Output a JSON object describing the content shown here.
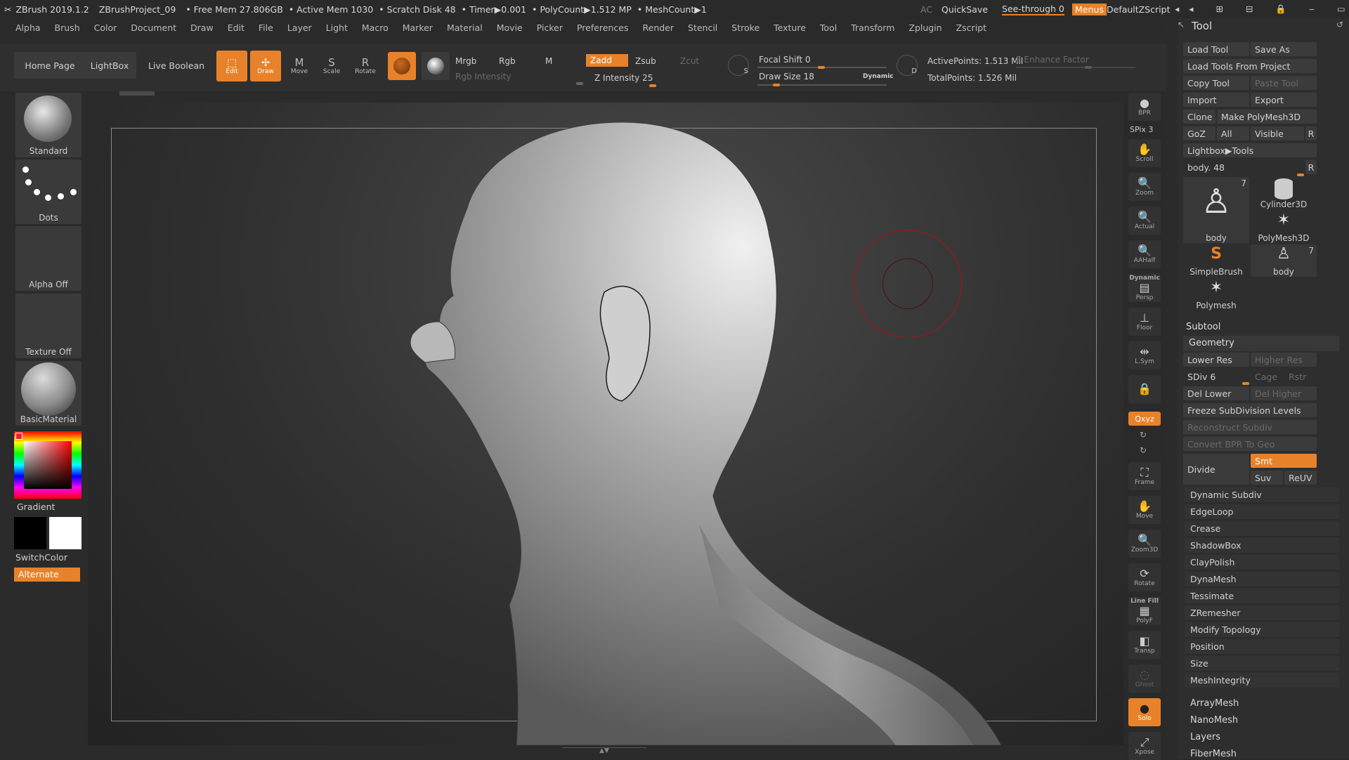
{
  "titlebar": {
    "app": "ZBrush 2019.1.2",
    "project": "ZBrushProject_09",
    "free_mem": "• Free Mem 27.806GB",
    "active_mem": "• Active Mem 1030",
    "scratch": "• Scratch Disk 48",
    "timer": "• Timer▶0.001",
    "polycount": "• PolyCount▶1.512 MP",
    "meshcount": "• MeshCount▶1",
    "ac": "AC",
    "quicksave": "QuickSave",
    "seethrough": "See-through  0",
    "menus": "Menus",
    "script": "DefaultZScript"
  },
  "menubar": [
    "Alpha",
    "Brush",
    "Color",
    "Document",
    "Draw",
    "Edit",
    "File",
    "Layer",
    "Light",
    "Macro",
    "Marker",
    "Material",
    "Movie",
    "Picker",
    "Preferences",
    "Render",
    "Stencil",
    "Stroke",
    "Texture",
    "Tool",
    "Transform",
    "Zplugin",
    "Zscript"
  ],
  "toolbar": {
    "home": "Home Page",
    "lightbox": "LightBox",
    "liveboolean": "Live Boolean",
    "edit": "Edit",
    "draw": "Draw",
    "move": "Move",
    "scale": "Scale",
    "rotate": "Rotate",
    "mrgb": "Mrgb",
    "rgb": "Rgb",
    "m": "M",
    "zadd": "Zadd",
    "zsub": "Zsub",
    "zcut": "Zcut",
    "rgb_intensity": "Rgb Intensity",
    "z_intensity": "Z Intensity 25",
    "focal_shift": "Focal Shift 0",
    "draw_size": "Draw Size 18",
    "dynamic": "Dynamic",
    "active_points": "ActivePoints: 1.513 Mil",
    "total_points": "TotalPoints: 1.526 Mil",
    "enhance": "E Enhance Factor",
    "s_label": "S",
    "d_label": "D"
  },
  "leftshelf": {
    "brush": "Standard",
    "stroke": "Dots",
    "alpha": "Alpha Off",
    "texture": "Texture Off",
    "material": "BasicMaterial",
    "gradient": "Gradient",
    "switchcolor": "SwitchColor",
    "alternate": "Alternate"
  },
  "rightshelf": {
    "bpr": "BPR",
    "spix": "SPix 3",
    "scroll": "Scroll",
    "zoom": "Zoom",
    "actual": "Actual",
    "aahalf": "AAHalf",
    "persp_top": "Dynamic",
    "persp": "Persp",
    "floor": "Floor",
    "lsym": "L.Sym",
    "xyz": "Qxyz",
    "frame": "Frame",
    "move": "Move",
    "zoom3d": "Zoom3D",
    "rotate": "Rotate",
    "linefill": "Line Fill",
    "polyf": "PolyF",
    "transp": "Transp",
    "ghost": "Ghost",
    "solo": "Solo",
    "xpose": "Xpose"
  },
  "toolpanel": {
    "title": "Tool",
    "load_tool": "Load Tool",
    "save_as": "Save As",
    "load_from_project": "Load Tools From Project",
    "copy_tool": "Copy Tool",
    "paste_tool": "Paste Tool",
    "import": "Import",
    "export": "Export",
    "clone": "Clone",
    "make_polymesh": "Make PolyMesh3D",
    "goz": "GoZ",
    "all": "All",
    "visible": "Visible",
    "r": "R",
    "lightbox_tools": "Lightbox▶Tools",
    "body_slider": "body. 48",
    "tiles": [
      "body",
      "Cylinder3D",
      "PolyMesh3D",
      "SimpleBrush",
      "body",
      "Polymesh"
    ],
    "tile_count": "7",
    "subtool": "Subtool",
    "geometry": "Geometry",
    "lower_res": "Lower Res",
    "higher_res": "Higher Res",
    "sdiv": "SDiv 6",
    "cage": "Cage",
    "rstr": "Rstr",
    "del_lower": "Del Lower",
    "del_higher": "Del Higher",
    "freeze": "Freeze SubDivision Levels",
    "reconstruct": "Reconstruct Subdiv",
    "convert_bpr": "Convert BPR To Geo",
    "divide": "Divide",
    "smt": "Smt",
    "suv": "Suv",
    "reuv": "ReUV",
    "geometry_items": [
      "Dynamic Subdiv",
      "EdgeLoop",
      "Crease",
      "ShadowBox",
      "ClayPolish",
      "DynaMesh",
      "Tessimate",
      "ZRemesher",
      "Modify Topology",
      "Position",
      "Size",
      "MeshIntegrity"
    ],
    "bottom_items": [
      "ArrayMesh",
      "NanoMesh",
      "Layers",
      "FiberMesh"
    ]
  }
}
